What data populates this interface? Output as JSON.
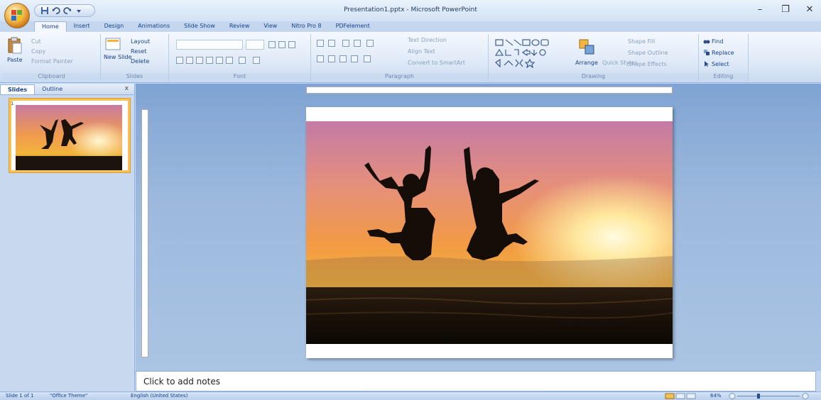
{
  "window": {
    "title": "Presentation1.pptx - Microsoft PowerPoint",
    "minimize": "–",
    "restore": "❐",
    "close": "✕"
  },
  "tabs": [
    "Home",
    "Insert",
    "Design",
    "Animations",
    "Slide Show",
    "Review",
    "View",
    "Nitro Pro 8",
    "PDFelement"
  ],
  "ribbon": {
    "clipboard": {
      "label": "Clipboard",
      "paste": "Paste",
      "cut": "Cut",
      "copy": "Copy",
      "format_painter": "Format Painter"
    },
    "slides": {
      "label": "Slides",
      "new_slide": "New Slide",
      "layout": "Layout",
      "reset": "Reset",
      "delete": "Delete"
    },
    "font": {
      "label": "Font"
    },
    "paragraph": {
      "label": "Paragraph",
      "text_direction": "Text Direction",
      "align_text": "Align Text",
      "convert_smartart": "Convert to SmartArt"
    },
    "drawing": {
      "label": "Drawing",
      "arrange": "Arrange",
      "quick_styles": "Quick Styles",
      "shape_fill": "Shape Fill",
      "shape_outline": "Shape Outline",
      "shape_effects": "Shape Effects"
    },
    "editing": {
      "label": "Editing",
      "find": "Find",
      "replace": "Replace",
      "select": "Select"
    }
  },
  "left_pane": {
    "tabs": [
      "Slides",
      "Outline"
    ],
    "close": "x",
    "slide_number": "1"
  },
  "notes": {
    "placeholder": "Click to add notes"
  },
  "status": {
    "slide": "Slide 1 of 1",
    "theme": "\"Office Theme\"",
    "language": "English (United States)",
    "zoom": "64%"
  },
  "colors": {
    "accent": "#15428b",
    "ribbon_bg": "#dfe9f7",
    "workspace": "#9cb9dd"
  }
}
